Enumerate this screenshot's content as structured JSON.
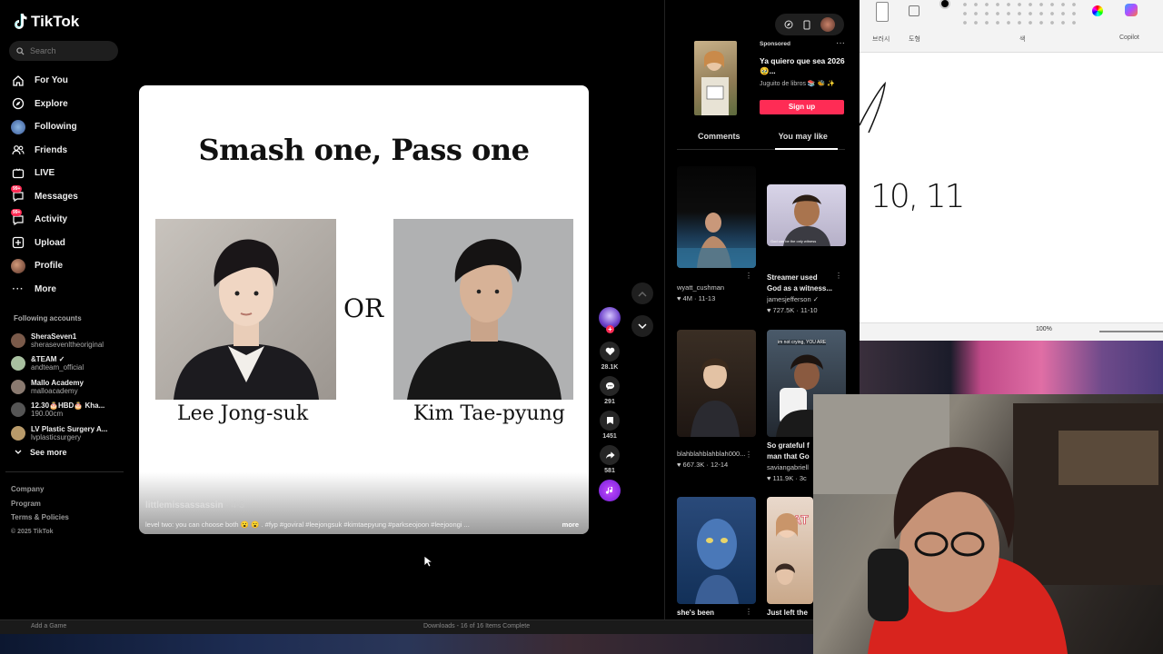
{
  "app": {
    "name": "TikTok"
  },
  "search": {
    "placeholder": "Search"
  },
  "nav": [
    {
      "label": "For You",
      "icon": "home-icon"
    },
    {
      "label": "Explore",
      "icon": "compass-icon"
    },
    {
      "label": "Following",
      "icon": "following-avatar-icon"
    },
    {
      "label": "Friends",
      "icon": "friends-icon"
    },
    {
      "label": "LIVE",
      "icon": "live-icon"
    },
    {
      "label": "Messages",
      "icon": "messages-icon",
      "badge": "99+"
    },
    {
      "label": "Activity",
      "icon": "activity-icon",
      "badge": "99+"
    },
    {
      "label": "Upload",
      "icon": "upload-icon"
    },
    {
      "label": "Profile",
      "icon": "profile-avatar-icon"
    },
    {
      "label": "More",
      "icon": "more-icon"
    }
  ],
  "following_accounts": {
    "title": "Following accounts",
    "items": [
      {
        "name": "SheraSeven1",
        "handle": "sherasevenltheoriginal",
        "color": "#7a5a4a"
      },
      {
        "name": "&TEAM ✓",
        "handle": "andteam_official",
        "color": "#a8c0a0"
      },
      {
        "name": "Mallo Academy",
        "handle": "malloacademy",
        "color": "#8a7a70"
      },
      {
        "name": "12.30🎂HBD🎂 Kha...",
        "handle": "190.00cm",
        "color": "#555555"
      },
      {
        "name": "LV Plastic Surgery A...",
        "handle": "lvplasticsurgery",
        "color": "#b89a6a"
      }
    ],
    "see_more": "See more"
  },
  "footer": {
    "links": [
      "Company",
      "Program",
      "Terms & Policies"
    ],
    "copyright": "© 2025 TikTok"
  },
  "video": {
    "title": "Smash one, Pass one",
    "or_text": "OR",
    "left_name": "Lee Jong-suk",
    "right_name": "Kim Tae-pyung",
    "author": "littlemissassassin",
    "date": "· 4-3",
    "caption": "level two: you can choose both 😮 😮 . #fyp #goviral #leejongsuk #kimtaepyung #parkseojoon #leejoongi ...",
    "more": "more"
  },
  "actions": {
    "likes": "28.1K",
    "comments": "291",
    "saves": "1451",
    "shares": "581"
  },
  "ad": {
    "sponsored": "Sponsored",
    "title": "Ya quiero que sea 2026 🥹...",
    "brand": "Juguito de libros 📚 🐝 ✨",
    "cta": "Sign up"
  },
  "right_tabs": {
    "comments": "Comments",
    "you_may_like": "You may like"
  },
  "cards": [
    {
      "title": "",
      "meta1": "wyatt_cushman",
      "meta2": "♥ 4M · 11-13"
    },
    {
      "title": "Streamer used",
      "title2": "God as a witness...",
      "meta1": "jamesjefferson ✓",
      "meta2": "♥ 727.5K · 11-10"
    },
    {
      "title": "",
      "meta1": "blahblahblahblah000...",
      "meta2": "♥ 667.3K · 12-14"
    },
    {
      "title": "So grateful f",
      "title2": "man that Go",
      "meta1": "saviangabriell",
      "meta2": "♥ 111.9K · 3c"
    },
    {
      "title": "she's been",
      "meta1": "",
      "meta2": ""
    },
    {
      "title": "Just left the",
      "meta1": "",
      "meta2": ""
    }
  ],
  "thumb_texts": {
    "streamer": "God can be the only witness",
    "grateful": "im not crying, YOU ARE"
  },
  "paint": {
    "label_left": "브러시",
    "label_shapes": "도형",
    "label_color": "색",
    "copilot": "Copilot",
    "zoom": "100%",
    "drawing": "10, 11"
  },
  "taskbar": {
    "left": "Add a Game",
    "downloads": "Downloads - 16 of 16 Items Complete"
  },
  "colors": {
    "accent": "#fe2c55",
    "background": "#000000"
  }
}
